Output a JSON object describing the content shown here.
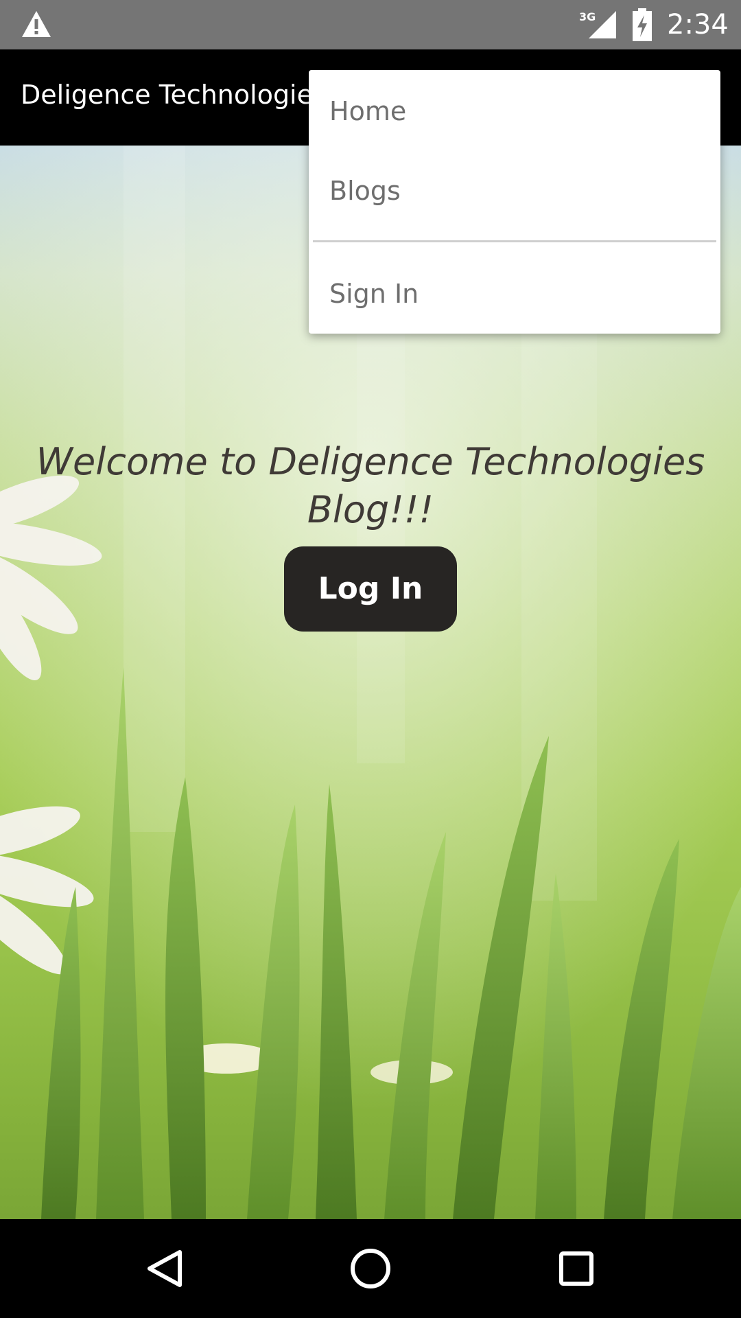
{
  "status_bar": {
    "time": "2:34",
    "network": "3G",
    "icons": [
      "warning-icon",
      "signal-icon",
      "battery-charging-icon"
    ]
  },
  "app_bar": {
    "title": "Deligence Technologies"
  },
  "menu": {
    "items": [
      {
        "label": "Home"
      },
      {
        "label": "Blogs"
      },
      {
        "label": "Sign In"
      }
    ]
  },
  "main": {
    "welcome": "Welcome to Deligence Technologies Blog!!!",
    "login_label": "Log In"
  },
  "nav_bar": {
    "icons": [
      "back-icon",
      "home-icon",
      "recents-icon"
    ]
  },
  "colors": {
    "status_bar": "#757575",
    "app_bar": "#000000",
    "button": "#272523",
    "menu_text": "#6e6e6e"
  }
}
